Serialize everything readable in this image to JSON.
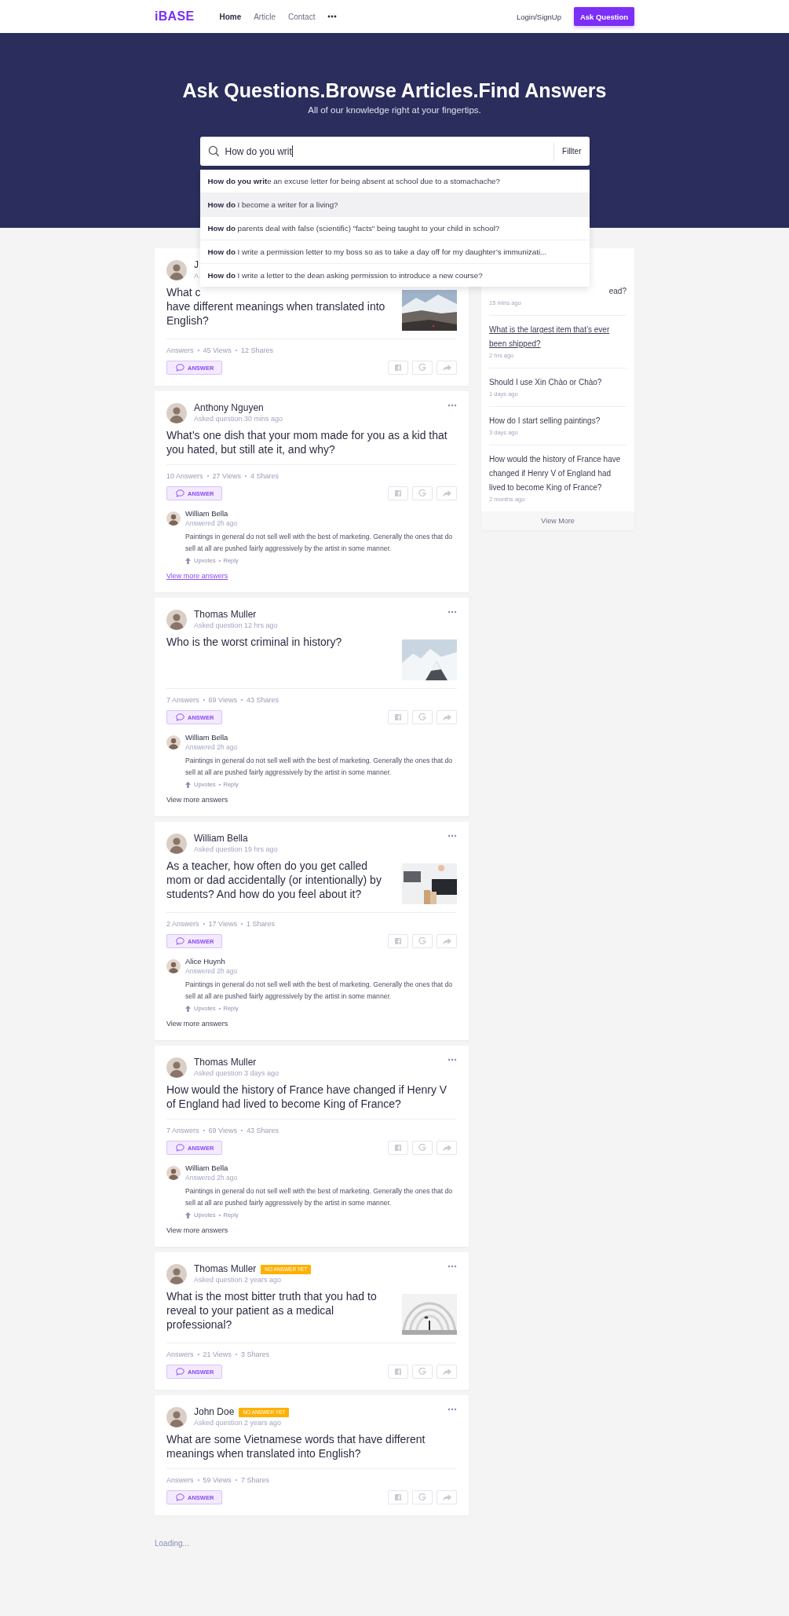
{
  "header": {
    "logo": "iBASE",
    "nav": [
      {
        "label": "Home",
        "selected": true
      },
      {
        "label": "Article",
        "selected": false
      },
      {
        "label": "Contact",
        "selected": false
      }
    ],
    "login": "Login/SignUp",
    "ask_button": "Ask Question"
  },
  "hero": {
    "title": "Ask Questions.Browse Articles.Find Answers",
    "subtitle": "All of our knowledge right at your fingertips.",
    "search": {
      "value": "How do you writ",
      "filter": "Fillter"
    },
    "suggestions": [
      {
        "text": "**How do you writ**e an excuse letter for being absent at school due to a stomachache?",
        "selected": false
      },
      {
        "text": "**How do** I become a writer for a living?",
        "selected": true
      },
      {
        "text": "**How do** parents deal with false (scientific) \"facts\" being taught to your child in school?",
        "selected": false
      },
      {
        "text": "**How do** I write a permission letter to my boss so as to take a day off for my daughter’s immunizati...",
        "selected": false
      },
      {
        "text": "**How do** I write a letter to the dean asking permission to introduce a new course?",
        "selected": false
      }
    ]
  },
  "questions": [
    {
      "author": "J",
      "meta": "A",
      "title_cut": "What c",
      "title": "have different meanings when translated into English?",
      "stats": [
        "Answers",
        "45 Views",
        "12 Shares"
      ],
      "answer_button": "ANSWER"
    },
    {
      "author": "Anthony Nguyen",
      "meta": "Asked question 30 mins ago",
      "title": "What’s one dish that your mom made for you as a kid that you hated, but still ate it, and why?",
      "stats": [
        "10 Answers",
        "27 Views",
        "4 Shares"
      ],
      "answer_button": "ANSWER",
      "answer": {
        "author": "William Bella",
        "meta": "Answered 2h ago",
        "body": "Paintings in general do not sell well with the best of marketing. Generally the ones that do sell at all are pushed fairly aggressively by the artist in some manner.",
        "actions": [
          "Upvotes",
          "Reply"
        ]
      },
      "more": {
        "text": "View more answers",
        "highlighted": true
      }
    },
    {
      "author": "Thomas Muller",
      "meta": "Asked question 12 hrs ago",
      "title": "Who is the worst criminal in history?",
      "stats": [
        "7 Answers",
        "69 Views",
        "43 Shares"
      ],
      "answer_button": "ANSWER",
      "answer": {
        "author": "William Bella",
        "meta": "Answered 2h ago",
        "body": "Paintings in general do not sell well with the best of marketing. Generally the ones that do sell at all are pushed fairly aggressively by the artist in some manner.",
        "actions": [
          "Upvotes",
          "Reply"
        ]
      },
      "more": {
        "text": "View more answers",
        "highlighted": false
      }
    },
    {
      "author": "William Bella",
      "meta": "Asked question 19 hrs ago",
      "title": "As a teacher, how often do you get called mom or dad accidentally (or intentionally) by students? And how do you feel about it?",
      "stats": [
        "2 Answers",
        "17 Views",
        "1 Shares"
      ],
      "answer_button": "ANSWER",
      "answer": {
        "author": "Alice Huynh",
        "meta": "Answered 2h ago",
        "body": "Paintings in general do not sell well with the best of marketing. Generally the ones that do sell at all are pushed fairly aggressively by the artist in some manner.",
        "actions": [
          "Upvotes",
          "Reply"
        ]
      },
      "more": {
        "text": "View more answers",
        "highlighted": false
      }
    },
    {
      "author": "Thomas Muller",
      "meta": "Asked question 3 days ago",
      "title": "How would the history of France have changed if Henry V of England had lived to become King of France?",
      "stats": [
        "7 Answers",
        "69 Views",
        "43 Shares"
      ],
      "answer_button": "ANSWER",
      "answer": {
        "author": "William Bella",
        "meta": "Answered 2h ago",
        "body": "Paintings in general do not sell well with the best of marketing. Generally the ones that do sell at all are pushed fairly aggressively by the artist in some manner.",
        "actions": [
          "Upvotes",
          "Reply"
        ]
      },
      "more": {
        "text": "View more answers",
        "highlighted": false
      }
    },
    {
      "author": "Thomas Muller",
      "badge": "NO ANSWER YET",
      "meta": "Asked question 2 years ago",
      "title": "What is the most bitter truth that you had to reveal to your patient as a medical professional?",
      "stats": [
        "Answers",
        "21 Views",
        "3 Shares"
      ],
      "answer_button": "ANSWER"
    },
    {
      "author": "John Doe",
      "badge": "NO ANSWER YET",
      "meta": "Asked question 2 years ago",
      "title": "What are some Vietnamese words that have different meanings when translated into English?",
      "stats": [
        "Answers",
        "59 Views",
        "7 Shares"
      ],
      "answer_button": "ANSWER"
    }
  ],
  "loading": "Loading...",
  "sidebar": {
    "items": [
      {
        "title": "ead?",
        "time": "15 mins ago",
        "highlighted": false
      },
      {
        "title": "What is the largest item that’s ever been shipped?",
        "time": "2 hrs ago",
        "highlighted": true
      },
      {
        "title": "Should I use Xin Chào or Chào?",
        "time": "1 days ago",
        "highlighted": false
      },
      {
        "title": "How do I start selling paintings?",
        "time": "3 days ago",
        "highlighted": false
      },
      {
        "title": "How would the history of France have changed if Henry V of England had lived to become King of France?",
        "time": "2 months ago",
        "highlighted": false
      }
    ],
    "footer": "View More"
  }
}
